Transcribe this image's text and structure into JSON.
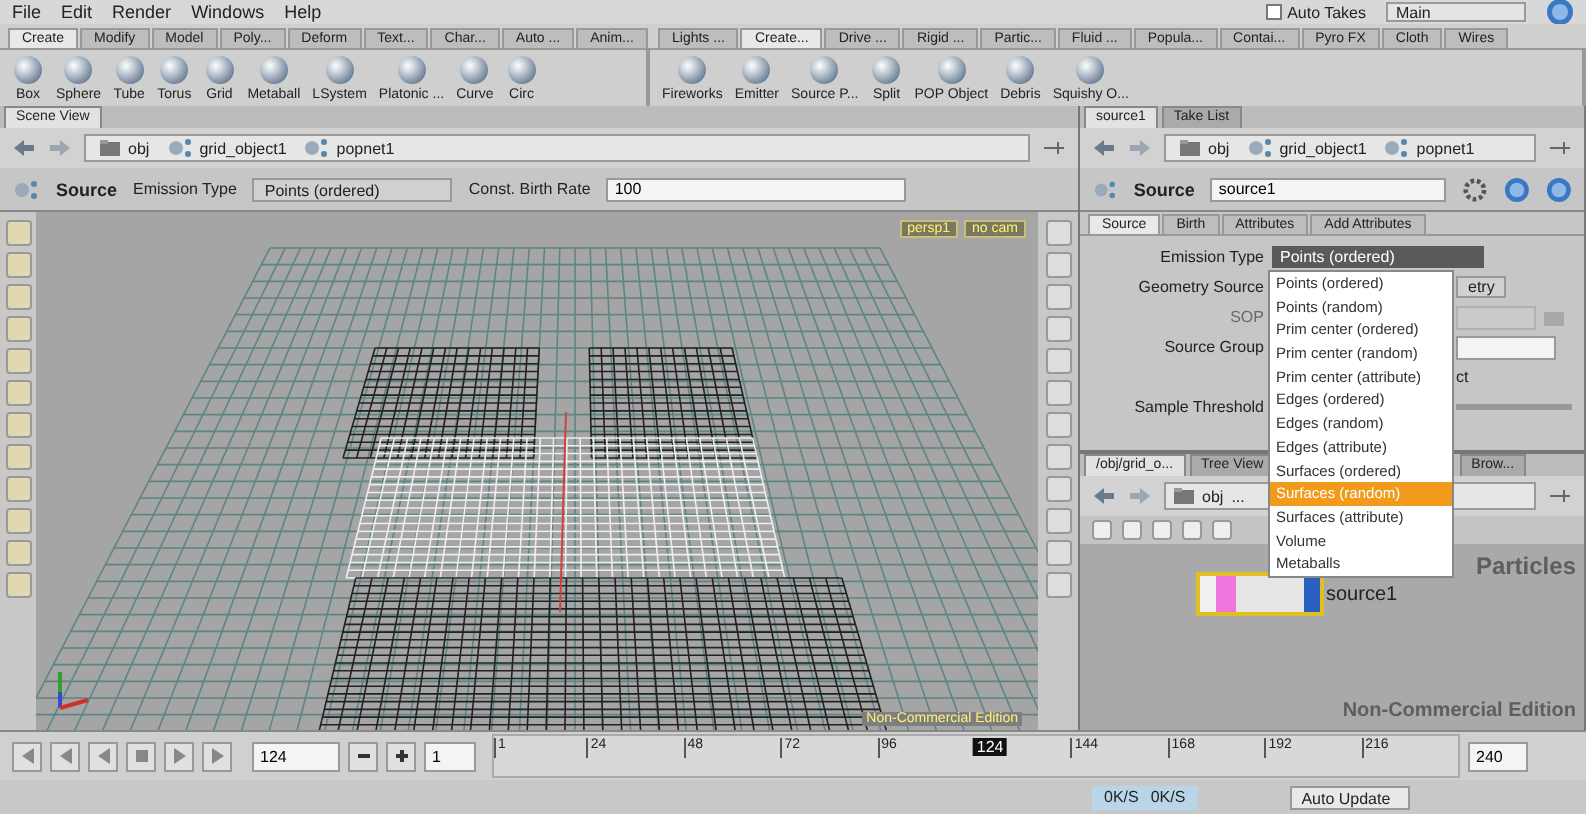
{
  "menu_bar": {
    "items": [
      "File",
      "Edit",
      "Render",
      "Windows",
      "Help"
    ],
    "auto_takes": {
      "label": "Auto Takes",
      "checked": false
    },
    "desktop": "Main"
  },
  "shelf_left": {
    "tabs": [
      {
        "label": "Create",
        "selected": true
      },
      {
        "label": "Modify",
        "selected": false
      },
      {
        "label": "Model",
        "selected": false
      },
      {
        "label": "Poly...",
        "selected": false
      },
      {
        "label": "Deform",
        "selected": false
      },
      {
        "label": "Text...",
        "selected": false
      },
      {
        "label": "Char...",
        "selected": false
      },
      {
        "label": "Auto ...",
        "selected": false
      },
      {
        "label": "Anim...",
        "selected": false
      }
    ],
    "tools": [
      "Box",
      "Sphere",
      "Tube",
      "Torus",
      "Grid",
      "Metaball",
      "LSystem",
      "Platonic ...",
      "Curve",
      "Circ"
    ]
  },
  "shelf_right": {
    "tabs": [
      {
        "label": "Lights ...",
        "selected": false
      },
      {
        "label": "Create...",
        "selected": true
      },
      {
        "label": "Drive ...",
        "selected": false
      },
      {
        "label": "Rigid ...",
        "selected": false
      },
      {
        "label": "Partic...",
        "selected": false
      },
      {
        "label": "Fluid ...",
        "selected": false
      },
      {
        "label": "Popula...",
        "selected": false
      },
      {
        "label": "Contai...",
        "selected": false
      },
      {
        "label": "Pyro FX",
        "selected": false
      },
      {
        "label": "Cloth",
        "selected": false
      },
      {
        "label": "Wires",
        "selected": false
      }
    ],
    "tools": [
      "Fireworks",
      "Emitter",
      "Source P...",
      "Split",
      "POP Object",
      "Debris",
      "Squishy O..."
    ]
  },
  "scene_view": {
    "tabs": [
      {
        "label": "Scene View",
        "selected": true
      }
    ],
    "path": [
      "obj",
      "grid_object1",
      "popnet1"
    ],
    "operator": "Source",
    "params": [
      {
        "label": "Emission Type",
        "value": "Points (ordered)",
        "kind": "menu"
      },
      {
        "label": "Const. Birth Rate",
        "value": "100",
        "kind": "field"
      }
    ],
    "viewport": {
      "camera": "persp1",
      "display": "no cam",
      "edition": "Non-Commercial Edition"
    }
  },
  "parameters": {
    "tabs": [
      {
        "label": "source1",
        "selected": true
      },
      {
        "label": "Take List",
        "selected": false
      }
    ],
    "path": [
      "obj",
      "grid_object1",
      "popnet1"
    ],
    "operator": "Source",
    "node_name": "source1",
    "param_tabs": [
      {
        "label": "Source",
        "selected": true
      },
      {
        "label": "Birth",
        "selected": false
      },
      {
        "label": "Attributes",
        "selected": false
      },
      {
        "label": "Add Attributes",
        "selected": false
      }
    ],
    "rows": [
      {
        "label": "Emission Type",
        "value": "Points (ordered)",
        "kind": "menu",
        "disabled": false
      },
      {
        "label": "Geometry Source",
        "value": "etry",
        "kind": "menu",
        "disabled": false
      },
      {
        "label": "SOP",
        "kind": "path",
        "disabled": true
      },
      {
        "label": "Source Group",
        "kind": "field",
        "disabled": false
      },
      {
        "value": "ct",
        "kind": "toggle",
        "disabled": false
      },
      {
        "label": "Sample Threshold",
        "kind": "slider",
        "disabled": false
      }
    ],
    "open_menu": [
      {
        "label": "Points (ordered)",
        "selected": false
      },
      {
        "label": "Points (random)",
        "selected": false
      },
      {
        "label": "Prim center (ordered)",
        "selected": false
      },
      {
        "label": "Prim center (random)",
        "selected": false
      },
      {
        "label": "Prim center (attribute)",
        "selected": false
      },
      {
        "label": "Edges (ordered)",
        "selected": false
      },
      {
        "label": "Edges (random)",
        "selected": false
      },
      {
        "label": "Edges (attribute)",
        "selected": false
      },
      {
        "label": "Surfaces (ordered)",
        "selected": false
      },
      {
        "label": "Surfaces (random)",
        "selected": true
      },
      {
        "label": "Surfaces (attribute)",
        "selected": false
      },
      {
        "label": "Volume",
        "selected": false
      },
      {
        "label": "Metaballs",
        "selected": false
      }
    ]
  },
  "network": {
    "tabs": [
      {
        "label": "/obj/grid_o...",
        "selected": true
      },
      {
        "label": "Tree View",
        "selected": false
      },
      {
        "label": "Brow...",
        "selected": false
      }
    ],
    "path": [
      "obj",
      "..."
    ],
    "context": "Particles",
    "node": {
      "name": "source1",
      "selected": true
    },
    "edition": "Non-Commercial Edition"
  },
  "timeline": {
    "frame": "124",
    "start": "1",
    "ticks": [
      "1",
      "24",
      "48",
      "72",
      "96",
      "144",
      "168",
      "192",
      "216"
    ],
    "current": "124",
    "end": "240"
  },
  "status_bar": {
    "download": "0K/S",
    "upload": "0K/S",
    "update_mode": "Auto Update"
  }
}
